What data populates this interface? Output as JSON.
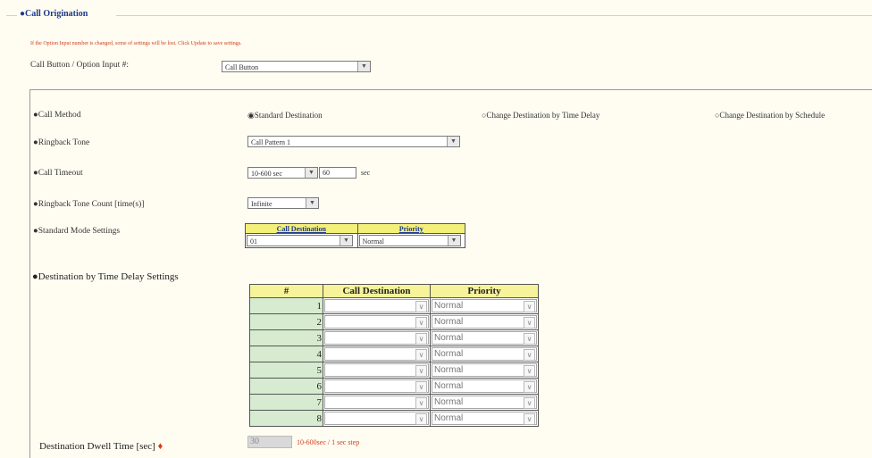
{
  "section": {
    "legend": "●Call Origination",
    "warning": "If the Option Input number is changed, some of settings will be lost. Click Update to save settings."
  },
  "call_button": {
    "label": "Call Button / Option Input #:",
    "value": "Call Button"
  },
  "call_method": {
    "label": "●Call Method",
    "options": [
      "◉Standard Destination",
      "○Change Destination by Time Delay",
      "○Change Destination by Schedule"
    ]
  },
  "ringback_tone": {
    "label": "●Ringback Tone",
    "value": "Call Pattern 1"
  },
  "call_timeout": {
    "label": "●Call Timeout",
    "value": "10-600 sec",
    "input_value": "60",
    "unit": "sec"
  },
  "ringback_count": {
    "label": "●Ringback Tone Count [time(s)]",
    "value": "Infinite"
  },
  "standard_mode": {
    "label": "●Standard Mode Settings",
    "headers": [
      "Call Destination",
      "Priority"
    ],
    "destination": "01",
    "priority": "Normal"
  },
  "delay_settings": {
    "title": "●Destination by Time Delay Settings",
    "headers": [
      "#",
      "Call Destination",
      "Priority"
    ],
    "rows": [
      {
        "num": "1",
        "destination": "",
        "priority": "Normal"
      },
      {
        "num": "2",
        "destination": "",
        "priority": "Normal"
      },
      {
        "num": "3",
        "destination": "",
        "priority": "Normal"
      },
      {
        "num": "4",
        "destination": "",
        "priority": "Normal"
      },
      {
        "num": "5",
        "destination": "",
        "priority": "Normal"
      },
      {
        "num": "6",
        "destination": "",
        "priority": "Normal"
      },
      {
        "num": "7",
        "destination": "",
        "priority": "Normal"
      },
      {
        "num": "8",
        "destination": "",
        "priority": "Normal"
      }
    ]
  },
  "dwell": {
    "label": "Destination Dwell Time [sec]",
    "required_mark": "♦",
    "value": "30",
    "hint": "10-600sec / 1 sec step"
  },
  "icons": {
    "dropdown": "chevron-down-icon"
  }
}
